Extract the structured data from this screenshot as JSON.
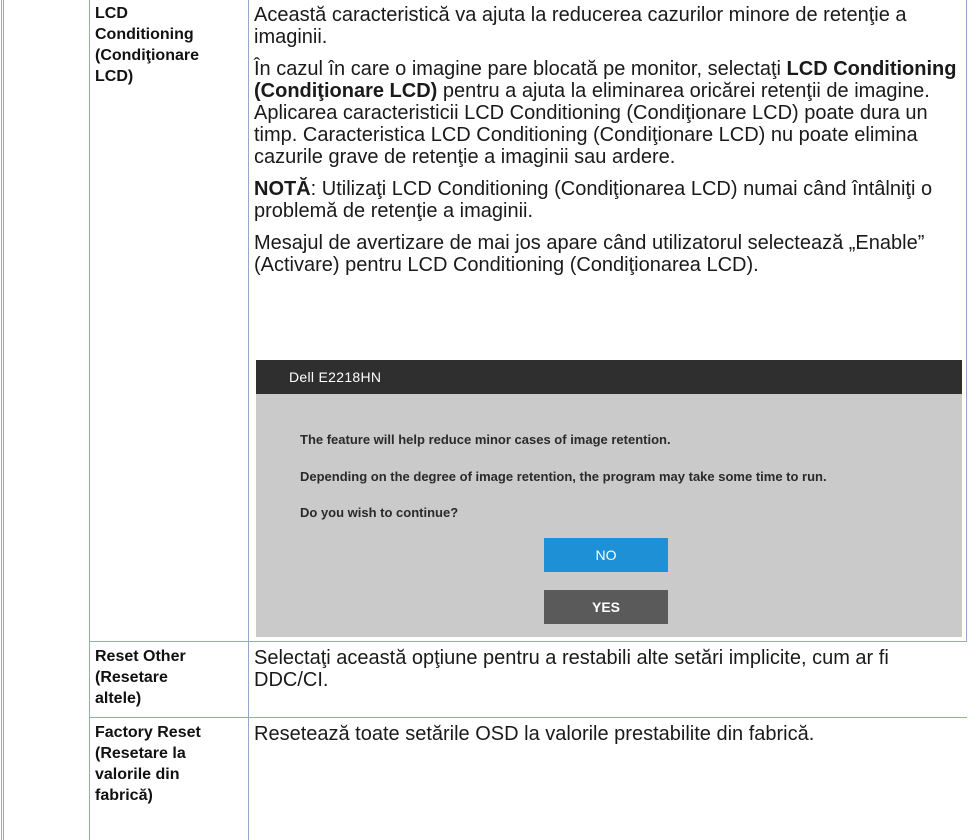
{
  "rows": [
    {
      "name": "LCD Conditioning (Condiţionare LCD)",
      "name_lines": [
        "LCD",
        "Conditioning",
        "(Condiţionare",
        "LCD)"
      ],
      "paragraphs": {
        "p1": "Această caracteristică va ajuta la reducerea cazurilor minore de retenţie a imaginii.",
        "p2_before": "În cazul în care o imagine pare blocată pe monitor, selectaţi ",
        "p2_bold": "LCD Conditioning (Condiţionare LCD)",
        "p2_after": " pentru a ajuta la eliminarea oricărei retenţii de imagine. Aplicarea caracteristicii LCD Conditioning (Condiţionare LCD) poate dura un timp. Caracteristica LCD Conditioning (Condiţionare LCD) nu poate elimina cazurile grave de retenţie a imaginii sau ardere.",
        "p3_bold": "NOTĂ",
        "p3_after": ": Utilizaţi LCD Conditioning (Condiţionarea LCD) numai când întâlniţi o problemă de retenţie a imaginii.",
        "p4": "Mesajul de avertizare de mai jos apare când utilizatorul selectează „Enable” (Activare) pentru LCD Conditioning (Condiţionarea LCD)."
      }
    },
    {
      "name": "Reset Other (Resetare altele)",
      "name_lines": [
        "Reset Other",
        "(Resetare",
        "altele)"
      ],
      "description": "Selectaţi această opţiune pentru a restabili alte setări implicite, cum ar fi DDC/CI."
    },
    {
      "name": "Factory Reset (Resetare la valorile din fabrică)",
      "name_lines": [
        "Factory Reset",
        "(Resetare la",
        "valorile din",
        "fabrică)"
      ],
      "description": "Resetează toate setările OSD la valorile prestabilite din fabrică."
    }
  ],
  "osd_dialog": {
    "title": "Dell  E2218HN",
    "messages": [
      "The feature will help reduce minor cases of image retention.",
      "Depending on the degree of image retention, the program may take some time to run.",
      "Do you wish to continue?"
    ],
    "no_label": "NO",
    "yes_label": "YES"
  },
  "colors": {
    "table_rule": "#93a9cc",
    "osd_title_bar": "#2f2f2f",
    "osd_background": "#cacaca",
    "no_button": "#1e90d6",
    "yes_button": "#5a5a5a"
  }
}
